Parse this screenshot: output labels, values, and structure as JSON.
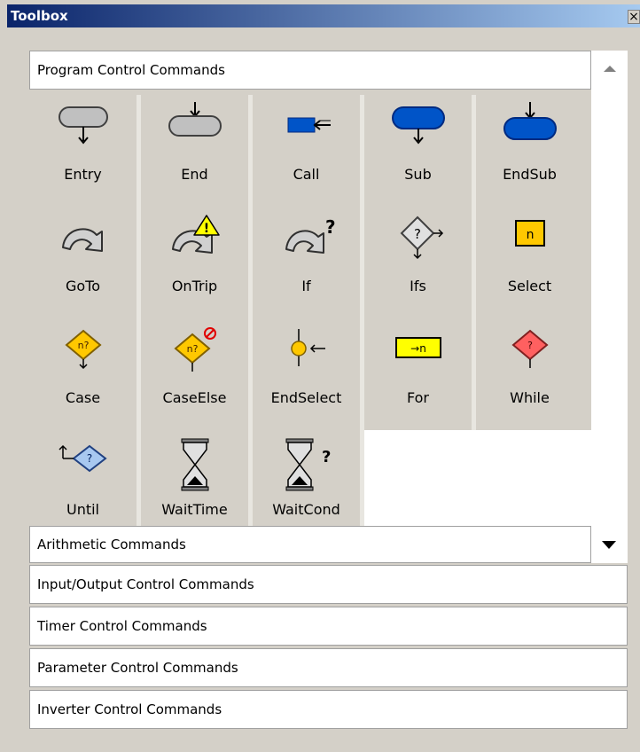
{
  "window": {
    "title": "Toolbox",
    "close_glyph": "×"
  },
  "categories": [
    {
      "label": "Program Control Commands",
      "expanded": true,
      "scroll": "up"
    },
    {
      "label": "Arithmetic Commands",
      "expanded": false,
      "scroll": "down"
    },
    {
      "label": "Input/Output Control Commands"
    },
    {
      "label": "Timer Control Commands"
    },
    {
      "label": "Parameter Control Commands"
    },
    {
      "label": "Inverter Control Commands"
    }
  ],
  "tools": [
    {
      "label": "Entry",
      "icon": "entry-icon"
    },
    {
      "label": "End",
      "icon": "end-icon"
    },
    {
      "label": "Call",
      "icon": "call-icon"
    },
    {
      "label": "Sub",
      "icon": "sub-icon"
    },
    {
      "label": "EndSub",
      "icon": "endsub-icon"
    },
    {
      "label": "GoTo",
      "icon": "goto-icon"
    },
    {
      "label": "OnTrip",
      "icon": "ontrip-icon"
    },
    {
      "label": "If",
      "icon": "if-icon"
    },
    {
      "label": "Ifs",
      "icon": "ifs-icon"
    },
    {
      "label": "Select",
      "icon": "select-icon",
      "glyph": "n"
    },
    {
      "label": "Case",
      "icon": "case-icon",
      "glyph": "n?"
    },
    {
      "label": "CaseElse",
      "icon": "caseelse-icon",
      "glyph": "n?"
    },
    {
      "label": "EndSelect",
      "icon": "endselect-icon"
    },
    {
      "label": "For",
      "icon": "for-icon",
      "glyph": "→n"
    },
    {
      "label": "While",
      "icon": "while-icon",
      "glyph": "?"
    },
    {
      "label": "Until",
      "icon": "until-icon",
      "glyph": "?"
    },
    {
      "label": "WaitTime",
      "icon": "waittime-icon"
    },
    {
      "label": "WaitCond",
      "icon": "waitcond-icon",
      "glyph": "?"
    }
  ],
  "colors": {
    "blue": "#0054c8",
    "gray": "#c0c0c0",
    "yellow": "#ffc800",
    "bright_yellow": "#ffff00",
    "red": "#ff6060",
    "light_blue": "#a8c8f0"
  }
}
